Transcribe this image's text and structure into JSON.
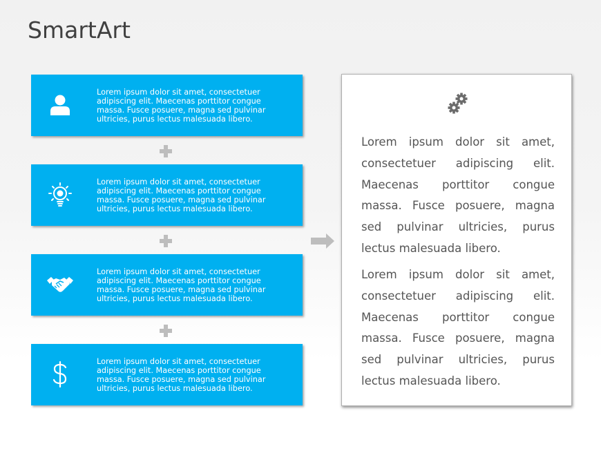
{
  "title": "SmartArt",
  "colors": {
    "box_fill": "#00b0f0",
    "box_text": "#ffffff",
    "title_text": "#404040",
    "panel_text": "#555555",
    "connector": "#bdbdbd"
  },
  "steps": [
    {
      "icon": "user-icon",
      "text": "Lorem ipsum dolor sit amet, consectetuer adipiscing elit. Maecenas porttitor congue massa. Fusce posuere, magna sed pulvinar ultricies, purus lectus malesuada libero."
    },
    {
      "icon": "lightbulb-icon",
      "text": "Lorem ipsum dolor sit amet, consectetuer adipiscing elit. Maecenas porttitor congue massa. Fusce posuere, magna sed pulvinar ultricies, purus lectus malesuada libero."
    },
    {
      "icon": "handshake-icon",
      "text": "Lorem ipsum dolor sit amet, consectetuer adipiscing elit. Maecenas porttitor congue massa. Fusce posuere, magna sed pulvinar ultricies, purus lectus malesuada libero."
    },
    {
      "icon": "dollar-icon",
      "text": "Lorem ipsum dolor sit amet, consectetuer adipiscing elit. Maecenas porttitor congue massa. Fusce posuere, magna sed pulvinar ultricies, purus lectus malesuada libero."
    }
  ],
  "connectors": [
    "plus-icon",
    "plus-icon",
    "plus-icon"
  ],
  "result_arrow": "arrow-right-icon",
  "result_panel": {
    "icon": "gears-icon",
    "paragraphs": [
      "Lorem ipsum dolor sit amet, consectetuer adipiscing elit. Maecenas porttitor congue massa. Fusce posuere, magna sed pulvinar ultricies, purus lectus malesuada libero.",
      "Lorem ipsum dolor sit amet, consectetuer adipiscing elit. Maecenas porttitor congue massa. Fusce posuere, magna sed pulvinar ultricies, purus lectus malesuada libero."
    ]
  }
}
